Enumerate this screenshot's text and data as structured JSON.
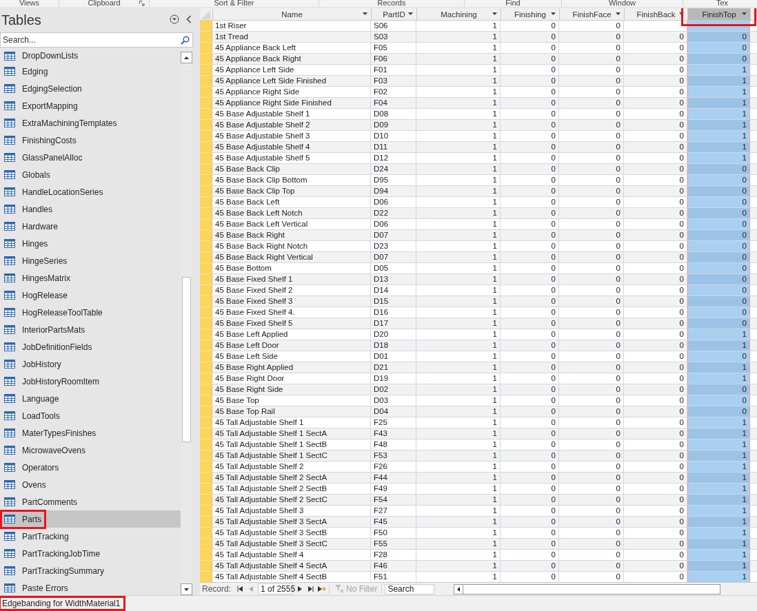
{
  "ribbon": {
    "groups": [
      {
        "label": "Views",
        "launcher": false
      },
      {
        "label": "Clipboard",
        "launcher": true
      },
      {
        "label": "Sort & Filter",
        "launcher": false
      },
      {
        "label": "Records",
        "launcher": false
      },
      {
        "label": "Find",
        "launcher": false
      },
      {
        "label": "Window",
        "launcher": false
      },
      {
        "label": "Tex",
        "launcher": false
      }
    ]
  },
  "navigation": {
    "title": "Tables",
    "search_placeholder": "Search...",
    "items": [
      {
        "label": "DropDownLists",
        "selected": false,
        "highlighted": false
      },
      {
        "label": "Edging",
        "selected": false,
        "highlighted": false
      },
      {
        "label": "EdgingSelection",
        "selected": false,
        "highlighted": false
      },
      {
        "label": "ExportMapping",
        "selected": false,
        "highlighted": false
      },
      {
        "label": "ExtraMachiningTemplates",
        "selected": false,
        "highlighted": false
      },
      {
        "label": "FinishingCosts",
        "selected": false,
        "highlighted": false
      },
      {
        "label": "GlassPanelAlloc",
        "selected": false,
        "highlighted": false
      },
      {
        "label": "Globals",
        "selected": false,
        "highlighted": false
      },
      {
        "label": "HandleLocationSeries",
        "selected": false,
        "highlighted": false
      },
      {
        "label": "Handles",
        "selected": false,
        "highlighted": false
      },
      {
        "label": "Hardware",
        "selected": false,
        "highlighted": false
      },
      {
        "label": "Hinges",
        "selected": false,
        "highlighted": false
      },
      {
        "label": "HingeSeries",
        "selected": false,
        "highlighted": false
      },
      {
        "label": "HingesMatrix",
        "selected": false,
        "highlighted": false
      },
      {
        "label": "HogRelease",
        "selected": false,
        "highlighted": false
      },
      {
        "label": "HogReleaseToolTable",
        "selected": false,
        "highlighted": false
      },
      {
        "label": "InteriorPartsMats",
        "selected": false,
        "highlighted": false
      },
      {
        "label": "JobDefinitionFields",
        "selected": false,
        "highlighted": false
      },
      {
        "label": "JobHistory",
        "selected": false,
        "highlighted": false
      },
      {
        "label": "JobHistoryRoomItem",
        "selected": false,
        "highlighted": false
      },
      {
        "label": "Language",
        "selected": false,
        "highlighted": false
      },
      {
        "label": "LoadTools",
        "selected": false,
        "highlighted": false
      },
      {
        "label": "MaterTypesFinishes",
        "selected": false,
        "highlighted": false
      },
      {
        "label": "MicrowaveOvens",
        "selected": false,
        "highlighted": false
      },
      {
        "label": "Operators",
        "selected": false,
        "highlighted": false
      },
      {
        "label": "Ovens",
        "selected": false,
        "highlighted": false
      },
      {
        "label": "PartComments",
        "selected": false,
        "highlighted": false
      },
      {
        "label": "Parts",
        "selected": true,
        "highlighted": true
      },
      {
        "label": "PartTracking",
        "selected": false,
        "highlighted": false
      },
      {
        "label": "PartTrackingJobTime",
        "selected": false,
        "highlighted": false
      },
      {
        "label": "PartTrackingSummary",
        "selected": false,
        "highlighted": false
      },
      {
        "label": "Paste Errors",
        "selected": false,
        "highlighted": false
      }
    ]
  },
  "datasheet": {
    "columns": [
      {
        "label": "Name",
        "kind": "text",
        "selected": false,
        "highlighted": false
      },
      {
        "label": "PartID",
        "kind": "text",
        "selected": false,
        "highlighted": false
      },
      {
        "label": "Machining",
        "kind": "number",
        "selected": false,
        "highlighted": false
      },
      {
        "label": "Finishing",
        "kind": "number",
        "selected": false,
        "highlighted": false
      },
      {
        "label": "FinishFace",
        "kind": "number",
        "selected": false,
        "highlighted": false
      },
      {
        "label": "FinishBack",
        "kind": "number",
        "selected": false,
        "highlighted": false
      },
      {
        "label": "FinishTop",
        "kind": "number",
        "selected": true,
        "highlighted": true
      }
    ],
    "rows": [
      {
        "cells": [
          "1st Riser",
          "S06",
          "1",
          "0",
          "0",
          null,
          null
        ]
      },
      {
        "cells": [
          "1st Tread",
          "S03",
          "1",
          "0",
          "0",
          "0",
          "0"
        ]
      },
      {
        "cells": [
          "45 Appliance Back Left",
          "F05",
          "1",
          "0",
          "0",
          "0",
          "0"
        ]
      },
      {
        "cells": [
          "45 Appliance Back Right",
          "F06",
          "1",
          "0",
          "0",
          "0",
          "0"
        ]
      },
      {
        "cells": [
          "45 Appliance Left Side",
          "F01",
          "1",
          "0",
          "0",
          "0",
          "1"
        ]
      },
      {
        "cells": [
          "45 Appliance Left Side Finished",
          "F03",
          "1",
          "0",
          "0",
          "0",
          "1"
        ]
      },
      {
        "cells": [
          "45 Appliance Right Side",
          "F02",
          "1",
          "0",
          "0",
          "0",
          "1"
        ]
      },
      {
        "cells": [
          "45 Appliance Right Side Finished",
          "F04",
          "1",
          "0",
          "0",
          "0",
          "1"
        ]
      },
      {
        "cells": [
          "45 Base Adjustable Shelf 1",
          "D08",
          "1",
          "0",
          "0",
          "0",
          "1"
        ]
      },
      {
        "cells": [
          "45 Base Adjustable Shelf 2",
          "D09",
          "1",
          "0",
          "0",
          "0",
          "1"
        ]
      },
      {
        "cells": [
          "45 Base Adjustable Shelf 3",
          "D10",
          "1",
          "0",
          "0",
          "0",
          "1"
        ]
      },
      {
        "cells": [
          "45 Base Adjustable Shelf 4",
          "D11",
          "1",
          "0",
          "0",
          "0",
          "1"
        ]
      },
      {
        "cells": [
          "45 Base Adjustable Shelf 5",
          "D12",
          "1",
          "0",
          "0",
          "0",
          "1"
        ]
      },
      {
        "cells": [
          "45 Base Back Clip",
          "D24",
          "1",
          "0",
          "0",
          "0",
          "0"
        ]
      },
      {
        "cells": [
          "45 Base Back Clip Bottom",
          "D95",
          "1",
          "0",
          "0",
          "0",
          "0"
        ]
      },
      {
        "cells": [
          "45 Base Back Clip Top",
          "D94",
          "1",
          "0",
          "0",
          "0",
          "0"
        ]
      },
      {
        "cells": [
          "45 Base Back Left",
          "D06",
          "1",
          "0",
          "0",
          "0",
          "0"
        ]
      },
      {
        "cells": [
          "45 Base Back Left Notch",
          "D22",
          "1",
          "0",
          "0",
          "0",
          "0"
        ]
      },
      {
        "cells": [
          "45 Base Back Left Vertical",
          "D06",
          "1",
          "0",
          "0",
          "0",
          "0"
        ]
      },
      {
        "cells": [
          "45 Base Back Right",
          "D07",
          "1",
          "0",
          "0",
          "0",
          "0"
        ]
      },
      {
        "cells": [
          "45 Base Back Right Notch",
          "D23",
          "1",
          "0",
          "0",
          "0",
          "0"
        ]
      },
      {
        "cells": [
          "45 Base Back Right Vertical",
          "D07",
          "1",
          "0",
          "0",
          "0",
          "0"
        ]
      },
      {
        "cells": [
          "45 Base Bottom",
          "D05",
          "1",
          "0",
          "0",
          "0",
          "0"
        ]
      },
      {
        "cells": [
          "45 Base Fixed Shelf 1",
          "D13",
          "1",
          "0",
          "0",
          "0",
          "0"
        ]
      },
      {
        "cells": [
          "45 Base Fixed Shelf 2",
          "D14",
          "1",
          "0",
          "0",
          "0",
          "0"
        ]
      },
      {
        "cells": [
          "45 Base Fixed Shelf 3",
          "D15",
          "1",
          "0",
          "0",
          "0",
          "0"
        ]
      },
      {
        "cells": [
          "45 Base Fixed Shelf 4.",
          "D16",
          "1",
          "0",
          "0",
          "0",
          "0"
        ]
      },
      {
        "cells": [
          "45 Base Fixed Shelf 5",
          "D17",
          "1",
          "0",
          "0",
          "0",
          "0"
        ]
      },
      {
        "cells": [
          "45 Base Left Applied",
          "D20",
          "1",
          "0",
          "0",
          "0",
          "1"
        ]
      },
      {
        "cells": [
          "45 Base Left Door",
          "D18",
          "1",
          "0",
          "0",
          "0",
          "1"
        ]
      },
      {
        "cells": [
          "45 Base Left Side",
          "D01",
          "1",
          "0",
          "0",
          "0",
          "0"
        ]
      },
      {
        "cells": [
          "45 Base Right Applied",
          "D21",
          "1",
          "0",
          "0",
          "0",
          "1"
        ]
      },
      {
        "cells": [
          "45 Base Right Door",
          "D19",
          "1",
          "0",
          "0",
          "0",
          "1"
        ]
      },
      {
        "cells": [
          "45 Base Right Side",
          "D02",
          "1",
          "0",
          "0",
          "0",
          "0"
        ]
      },
      {
        "cells": [
          "45 Base Top",
          "D03",
          "1",
          "0",
          "0",
          "0",
          "0"
        ]
      },
      {
        "cells": [
          "45 Base Top Rail",
          "D04",
          "1",
          "0",
          "0",
          "0",
          "0"
        ]
      },
      {
        "cells": [
          "45 Tall Adjustable Shelf 1",
          "F25",
          "1",
          "0",
          "0",
          "0",
          "1"
        ]
      },
      {
        "cells": [
          "45 Tall Adjustable Shelf 1 SectA",
          "F43",
          "1",
          "0",
          "0",
          "0",
          "1"
        ]
      },
      {
        "cells": [
          "45 Tall Adjustable Shelf 1 SectB",
          "F48",
          "1",
          "0",
          "0",
          "0",
          "1"
        ]
      },
      {
        "cells": [
          "45 Tall Adjustable Shelf 1 SectC",
          "F53",
          "1",
          "0",
          "0",
          "0",
          "1"
        ]
      },
      {
        "cells": [
          "45 Tall Adjustable Shelf 2",
          "F26",
          "1",
          "0",
          "0",
          "0",
          "1"
        ]
      },
      {
        "cells": [
          "45 Tall Adjustable Shelf 2 SectA",
          "F44",
          "1",
          "0",
          "0",
          "0",
          "1"
        ]
      },
      {
        "cells": [
          "45 Tall Adjustable Shelf 2 SectB",
          "F49",
          "1",
          "0",
          "0",
          "0",
          "1"
        ]
      },
      {
        "cells": [
          "45 Tall Adjustable Shelf 2 SectC",
          "F54",
          "1",
          "0",
          "0",
          "0",
          "1"
        ]
      },
      {
        "cells": [
          "45 Tall Adjustable Shelf 3",
          "F27",
          "1",
          "0",
          "0",
          "0",
          "1"
        ]
      },
      {
        "cells": [
          "45 Tall Adjustable Shelf 3 SectA",
          "F45",
          "1",
          "0",
          "0",
          "0",
          "1"
        ]
      },
      {
        "cells": [
          "45 Tall Adjustable Shelf 3 SectB",
          "F50",
          "1",
          "0",
          "0",
          "0",
          "1"
        ]
      },
      {
        "cells": [
          "45 Tall Adjustable Shelf 3 SectC",
          "F55",
          "1",
          "0",
          "0",
          "0",
          "1"
        ]
      },
      {
        "cells": [
          "45 Tall Adjustable Shelf 4",
          "F28",
          "1",
          "0",
          "0",
          "0",
          "1"
        ]
      },
      {
        "cells": [
          "45 Tall Adjustable Shelf 4 SectA",
          "F46",
          "1",
          "0",
          "0",
          "0",
          "1"
        ]
      },
      {
        "cells": [
          "45 Tall Adjustable Shelf 4 SectB",
          "F51",
          "1",
          "0",
          "0",
          "0",
          "1"
        ]
      }
    ]
  },
  "record_navigator": {
    "label": "Record:",
    "position": "1 of 2555",
    "filter": "No Filter",
    "filter_active": false,
    "search_placeholder": "Search"
  },
  "status_bar": {
    "text": "Edgebanding for WidthMaterial1",
    "highlighted": true
  }
}
